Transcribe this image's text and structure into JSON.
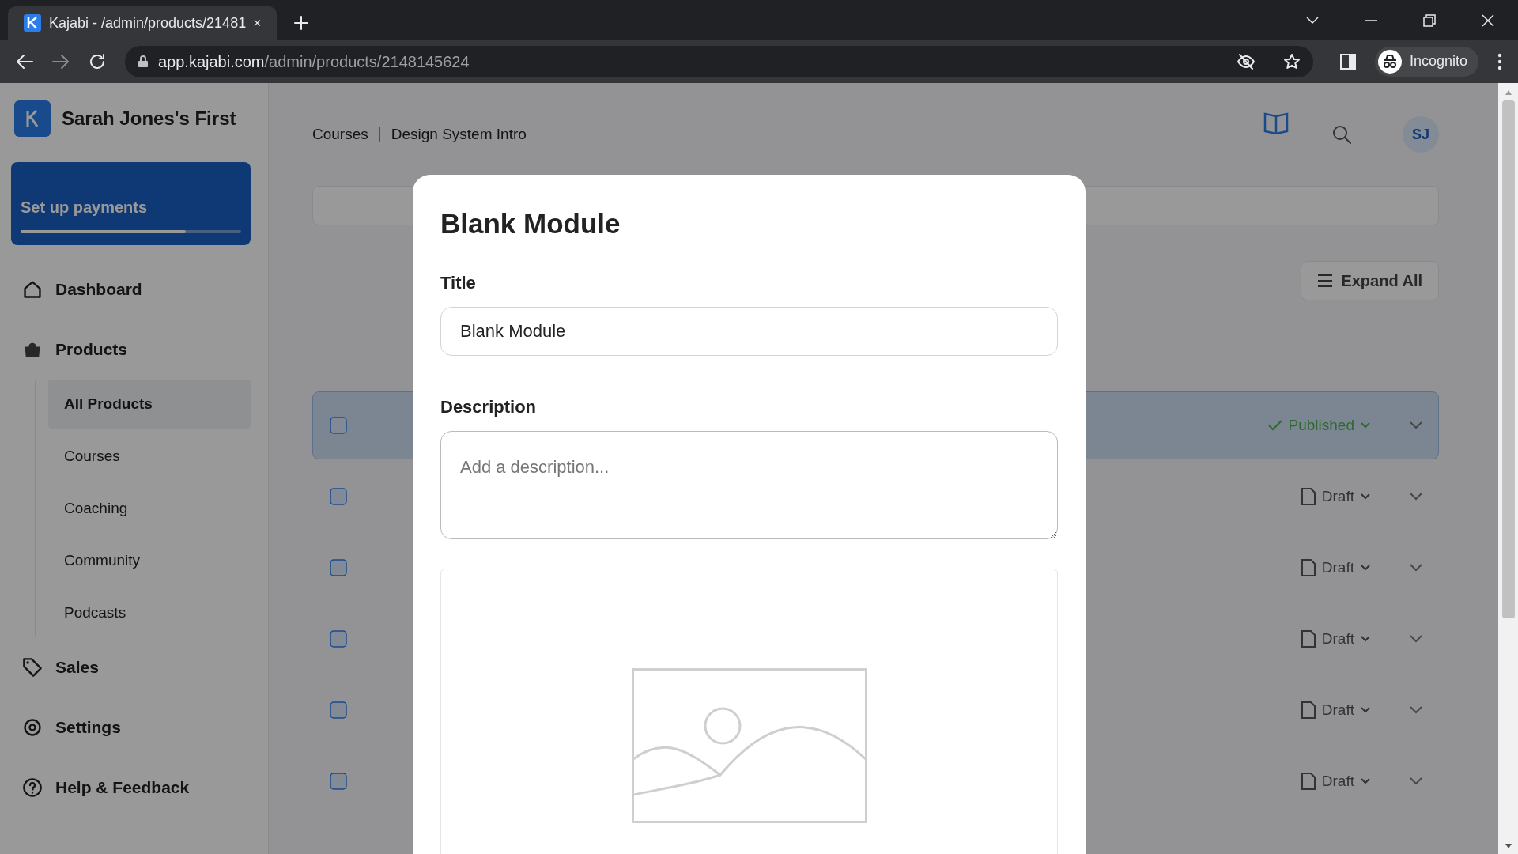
{
  "browser": {
    "tab_title": "Kajabi - /admin/products/21481",
    "url_host": "app.kajabi.com",
    "url_path": "/admin/products/2148145624",
    "profile_label": "Incognito"
  },
  "sidebar": {
    "brand": "Sarah Jones's First",
    "setup_card": {
      "title": "Set up payments",
      "level": 0.75
    },
    "items": [
      {
        "label": "Dashboard"
      },
      {
        "label": "Products",
        "children": [
          {
            "label": "All Products",
            "selected": true
          },
          {
            "label": "Courses",
            "selected": false
          },
          {
            "label": "Coaching",
            "selected": false
          },
          {
            "label": "Community",
            "selected": false
          },
          {
            "label": "Podcasts",
            "selected": false
          }
        ]
      },
      {
        "label": "Sales"
      },
      {
        "label": "Settings"
      },
      {
        "label": "Help & Feedback"
      }
    ]
  },
  "header": {
    "breadcrumb": [
      "Courses",
      "Design System Intro"
    ],
    "avatar": "SJ"
  },
  "toolbar": {
    "expand_button": "Expand All"
  },
  "rows": [
    {
      "selected": true,
      "status": "Published",
      "kind": "published"
    },
    {
      "selected": false,
      "status": "Draft",
      "kind": "draft"
    },
    {
      "selected": false,
      "status": "Draft",
      "kind": "draft"
    },
    {
      "selected": false,
      "status": "Draft",
      "kind": "draft"
    },
    {
      "selected": false,
      "status": "Draft",
      "kind": "draft"
    },
    {
      "selected": false,
      "status": "Draft",
      "kind": "draft"
    }
  ],
  "modal": {
    "title": "Blank Module",
    "title_label": "Title",
    "title_value": "Blank Module",
    "description_label": "Description",
    "description_placeholder": "Add a description..."
  }
}
